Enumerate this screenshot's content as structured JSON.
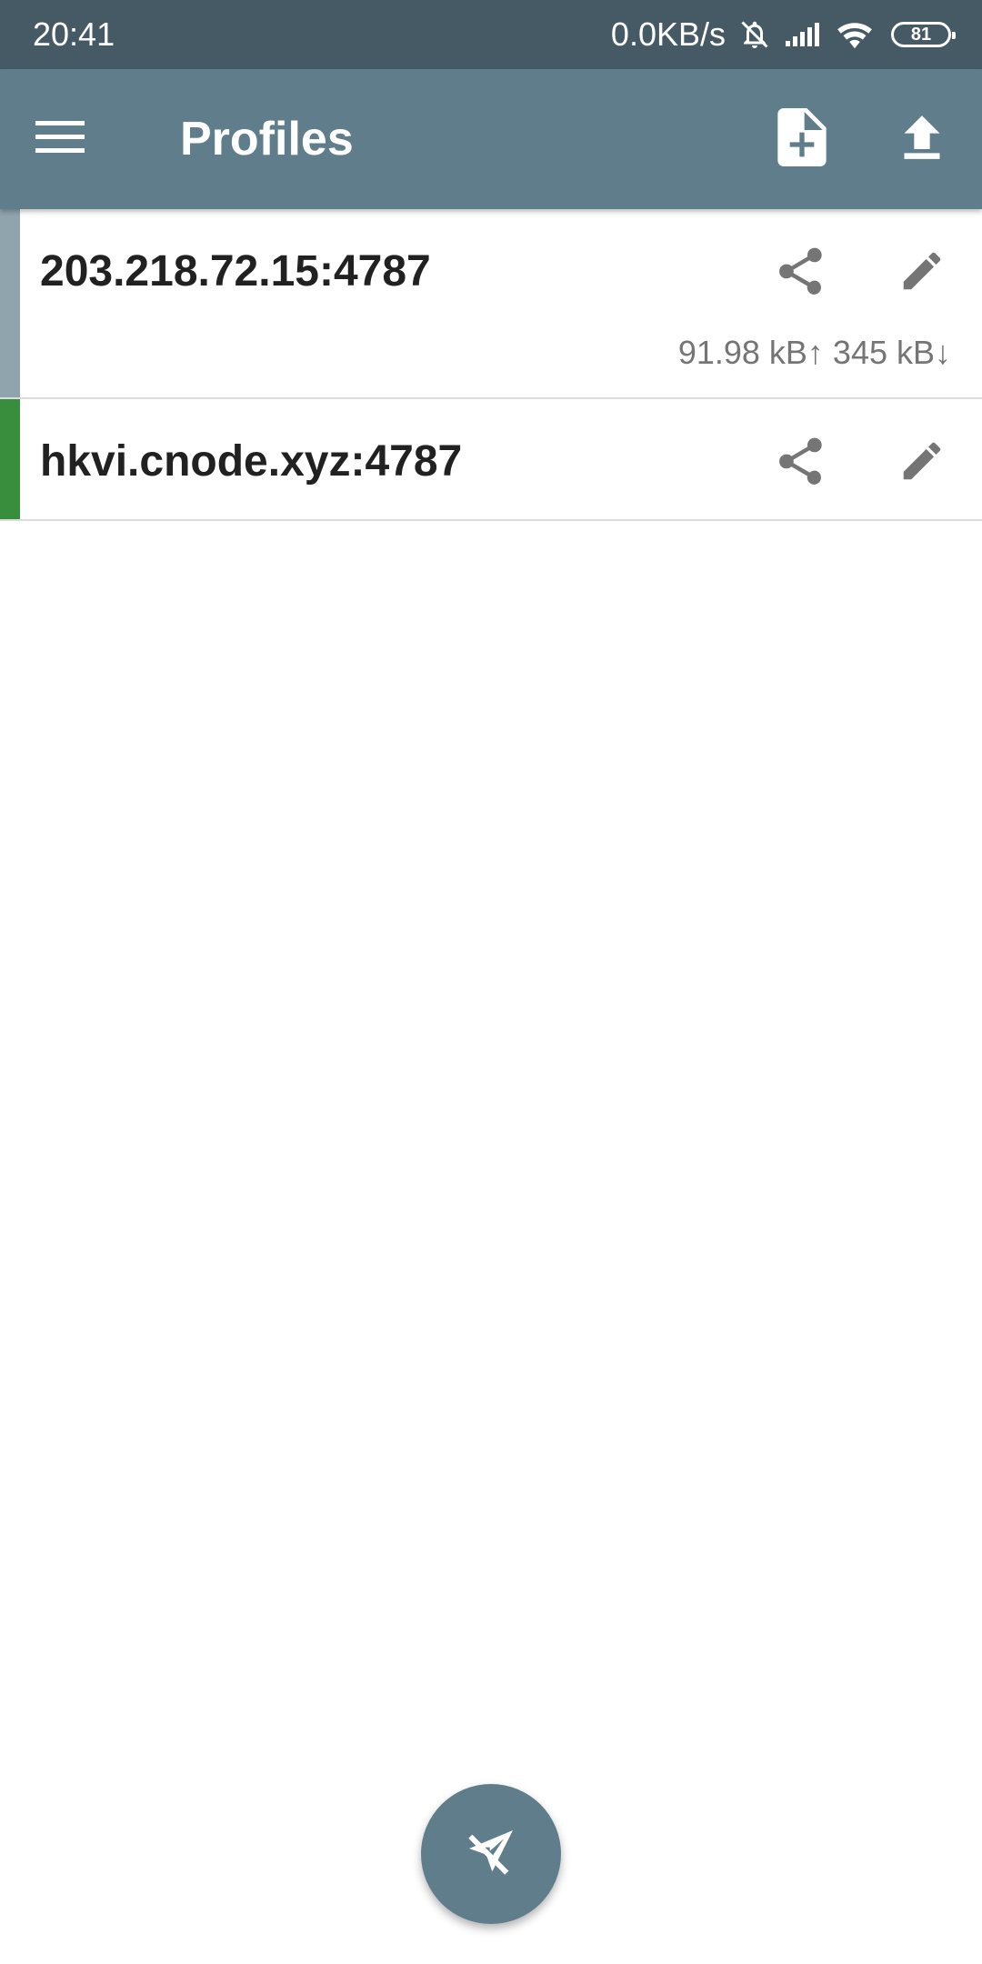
{
  "status_bar": {
    "time": "20:41",
    "net_speed": "0.0KB/s",
    "battery_level": "81",
    "icons": [
      "bell-off-icon",
      "signal-icon",
      "wifi-icon",
      "battery-icon"
    ]
  },
  "app_bar": {
    "title": "Profiles",
    "icons": [
      "menu-icon",
      "file-add-icon",
      "upload-icon"
    ]
  },
  "profiles": [
    {
      "name": "203.218.72.15:4787",
      "traffic": "91.98 kB↑ 345 kB↓",
      "strip_color": "#90a4ae",
      "icons": [
        "share-icon",
        "edit-icon"
      ]
    },
    {
      "name": "hkvi.cnode.xyz:4787",
      "strip_color": "#388e3c",
      "icons": [
        "share-icon",
        "edit-icon"
      ]
    }
  ],
  "fab": {
    "icon": "paper-plane-off-icon"
  },
  "colors": {
    "status_bar": "#455a64",
    "app_bar": "#607d8b",
    "fab": "#607d8b",
    "text_primary": "#212121",
    "text_secondary": "#757575",
    "icon_gray": "#757575"
  }
}
